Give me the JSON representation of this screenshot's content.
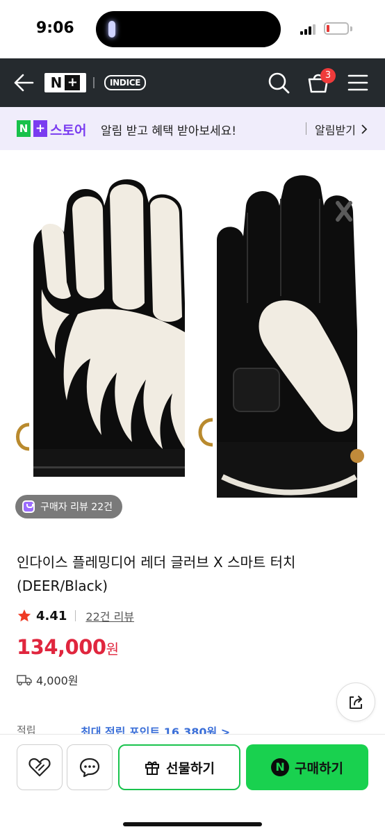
{
  "status_bar": {
    "time": "9:06"
  },
  "header": {
    "logo_n": "N",
    "logo_plus": "+",
    "brand_badge": "INDICE",
    "cart_count": "3"
  },
  "notice": {
    "store_n": "N",
    "store_plus": "+",
    "store_name": "스토어",
    "message": "알림 받고 혜택 받아보세요!",
    "link_label": "알림받기"
  },
  "product": {
    "review_chip": "구매자 리뷰 22건",
    "title": "인다이스 플레밍디어 레더 글러브 X 스마트 터치 (DEER/Black)",
    "rating": "4.41",
    "review_link": "22건 리뷰",
    "price": "134,000",
    "price_unit": "원",
    "shipping_fee": "4,000원",
    "points_label": "적립",
    "points_link": "최대 적립 포인트 16,380원 >"
  },
  "actions": {
    "gift_label": "선물하기",
    "buy_badge": "N",
    "buy_label": "구매하기"
  },
  "colors": {
    "header_bg": "#252a2e",
    "notice_bg": "#f0edfb",
    "naver_green": "#19d14f",
    "accent_purple": "#7a3cf0",
    "price_red": "#e0263e",
    "star_red": "#ef3b24",
    "cart_badge": "#ef3b3b"
  },
  "icons": [
    "back-arrow-icon",
    "search-icon",
    "cart-icon",
    "menu-icon",
    "chevron-right-icon",
    "star-icon",
    "truck-icon",
    "share-icon",
    "heart-icon",
    "chat-icon",
    "gift-icon"
  ]
}
